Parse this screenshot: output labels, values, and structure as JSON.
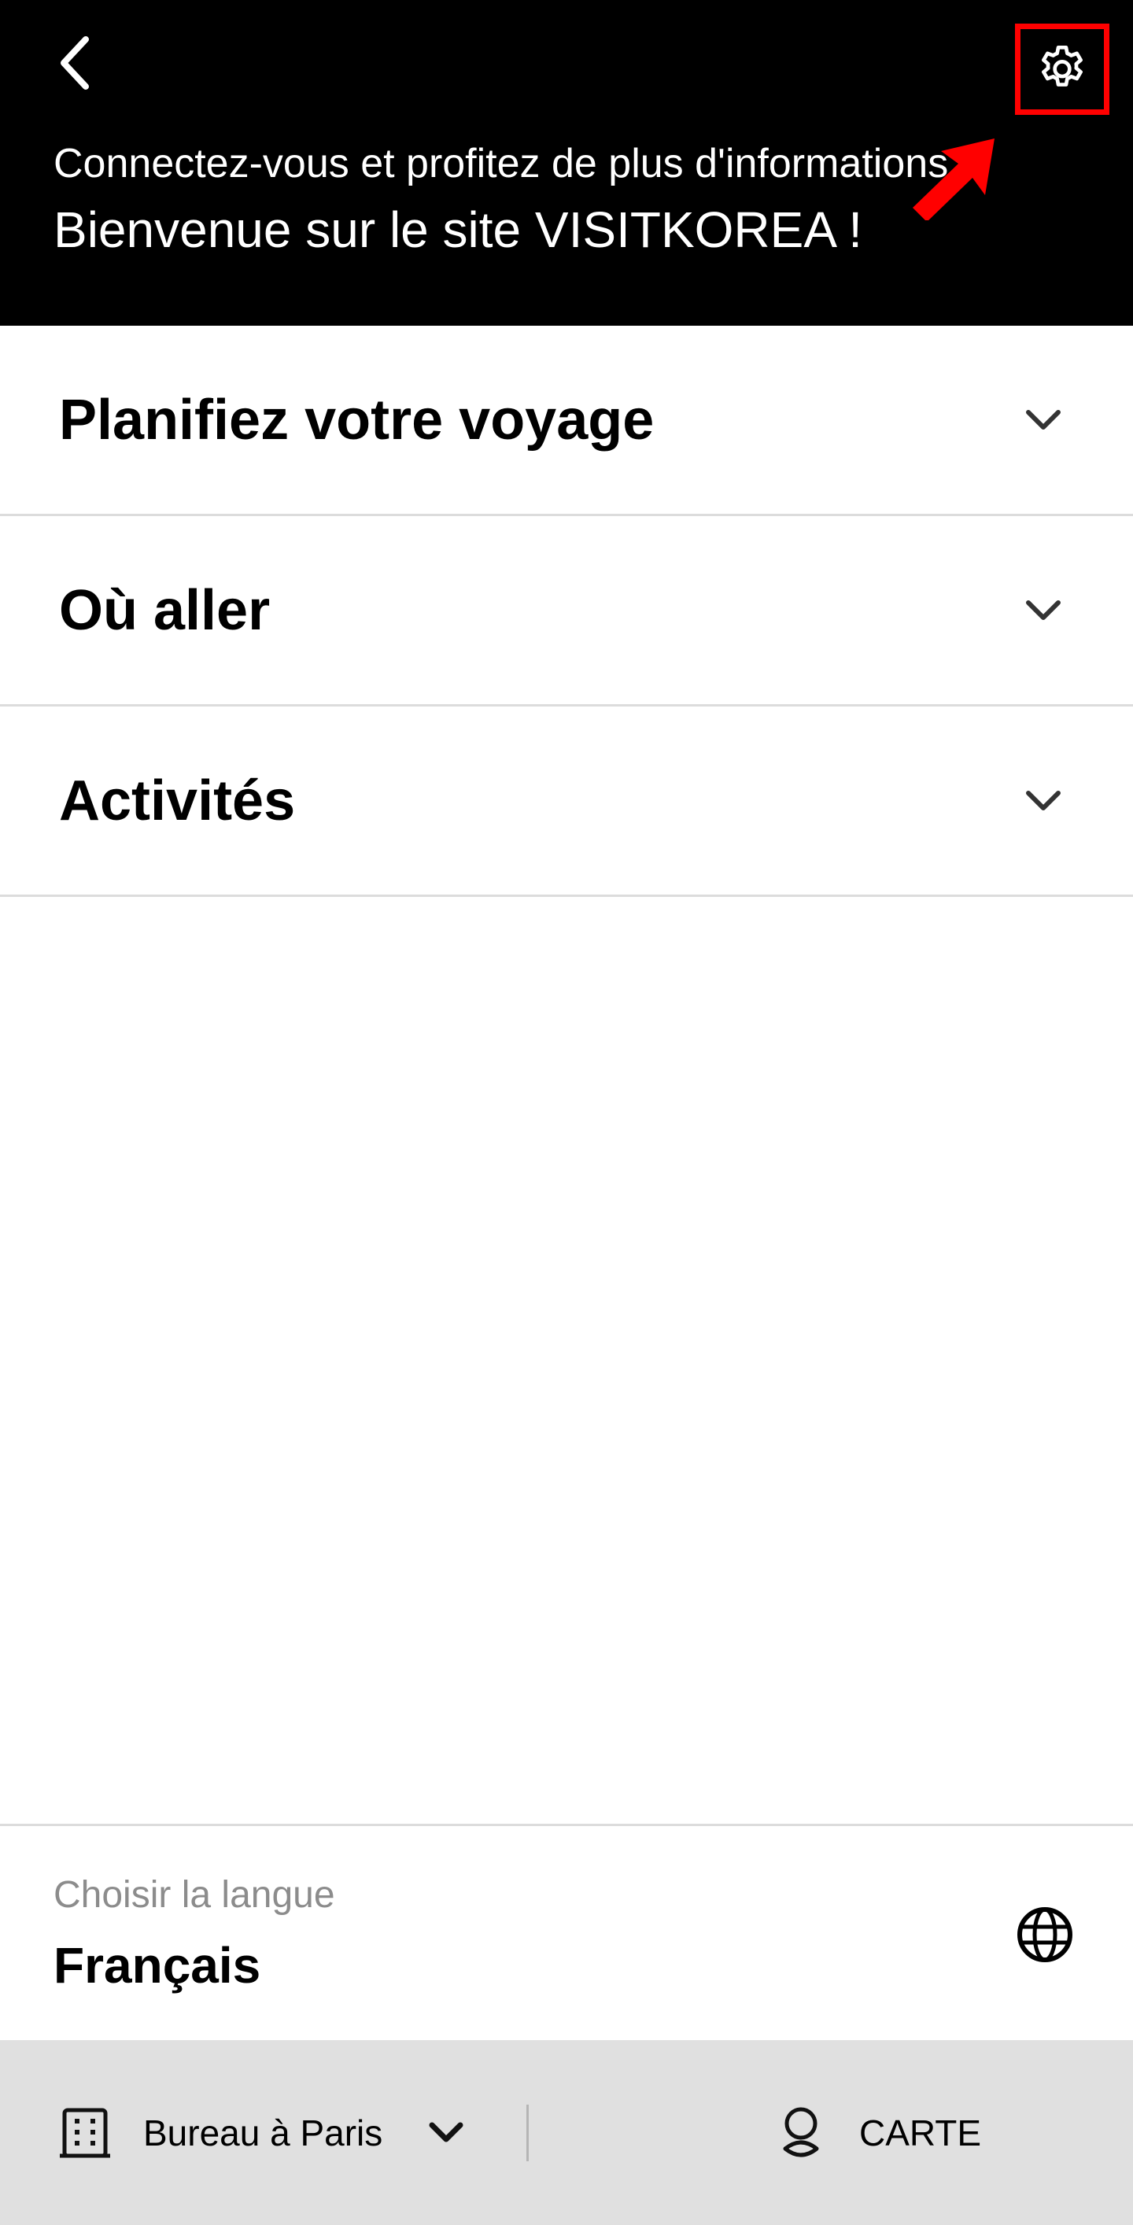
{
  "header": {
    "login_prompt": "Connectez-vous et profitez de plus d'informations !",
    "welcome": "Bienvenue sur le site VISITKOREA !",
    "back_icon": "chevron-left-icon",
    "settings_icon": "gear-icon",
    "background_color": "#000000",
    "highlight_color": "#ff0000"
  },
  "menu": {
    "items": [
      {
        "label": "Planifiez votre voyage",
        "icon": "chevron-down-icon"
      },
      {
        "label": "Où aller",
        "icon": "chevron-down-icon"
      },
      {
        "label": "Activités",
        "icon": "chevron-down-icon"
      }
    ]
  },
  "language": {
    "caption": "Choisir la langue",
    "value": "Français",
    "icon": "globe-icon"
  },
  "bottom_bar": {
    "office_label": "Bureau à Paris",
    "office_icon": "building-icon",
    "map_label": "CARTE",
    "map_icon": "map-pin-icon",
    "background_color": "#e0e0e0"
  }
}
